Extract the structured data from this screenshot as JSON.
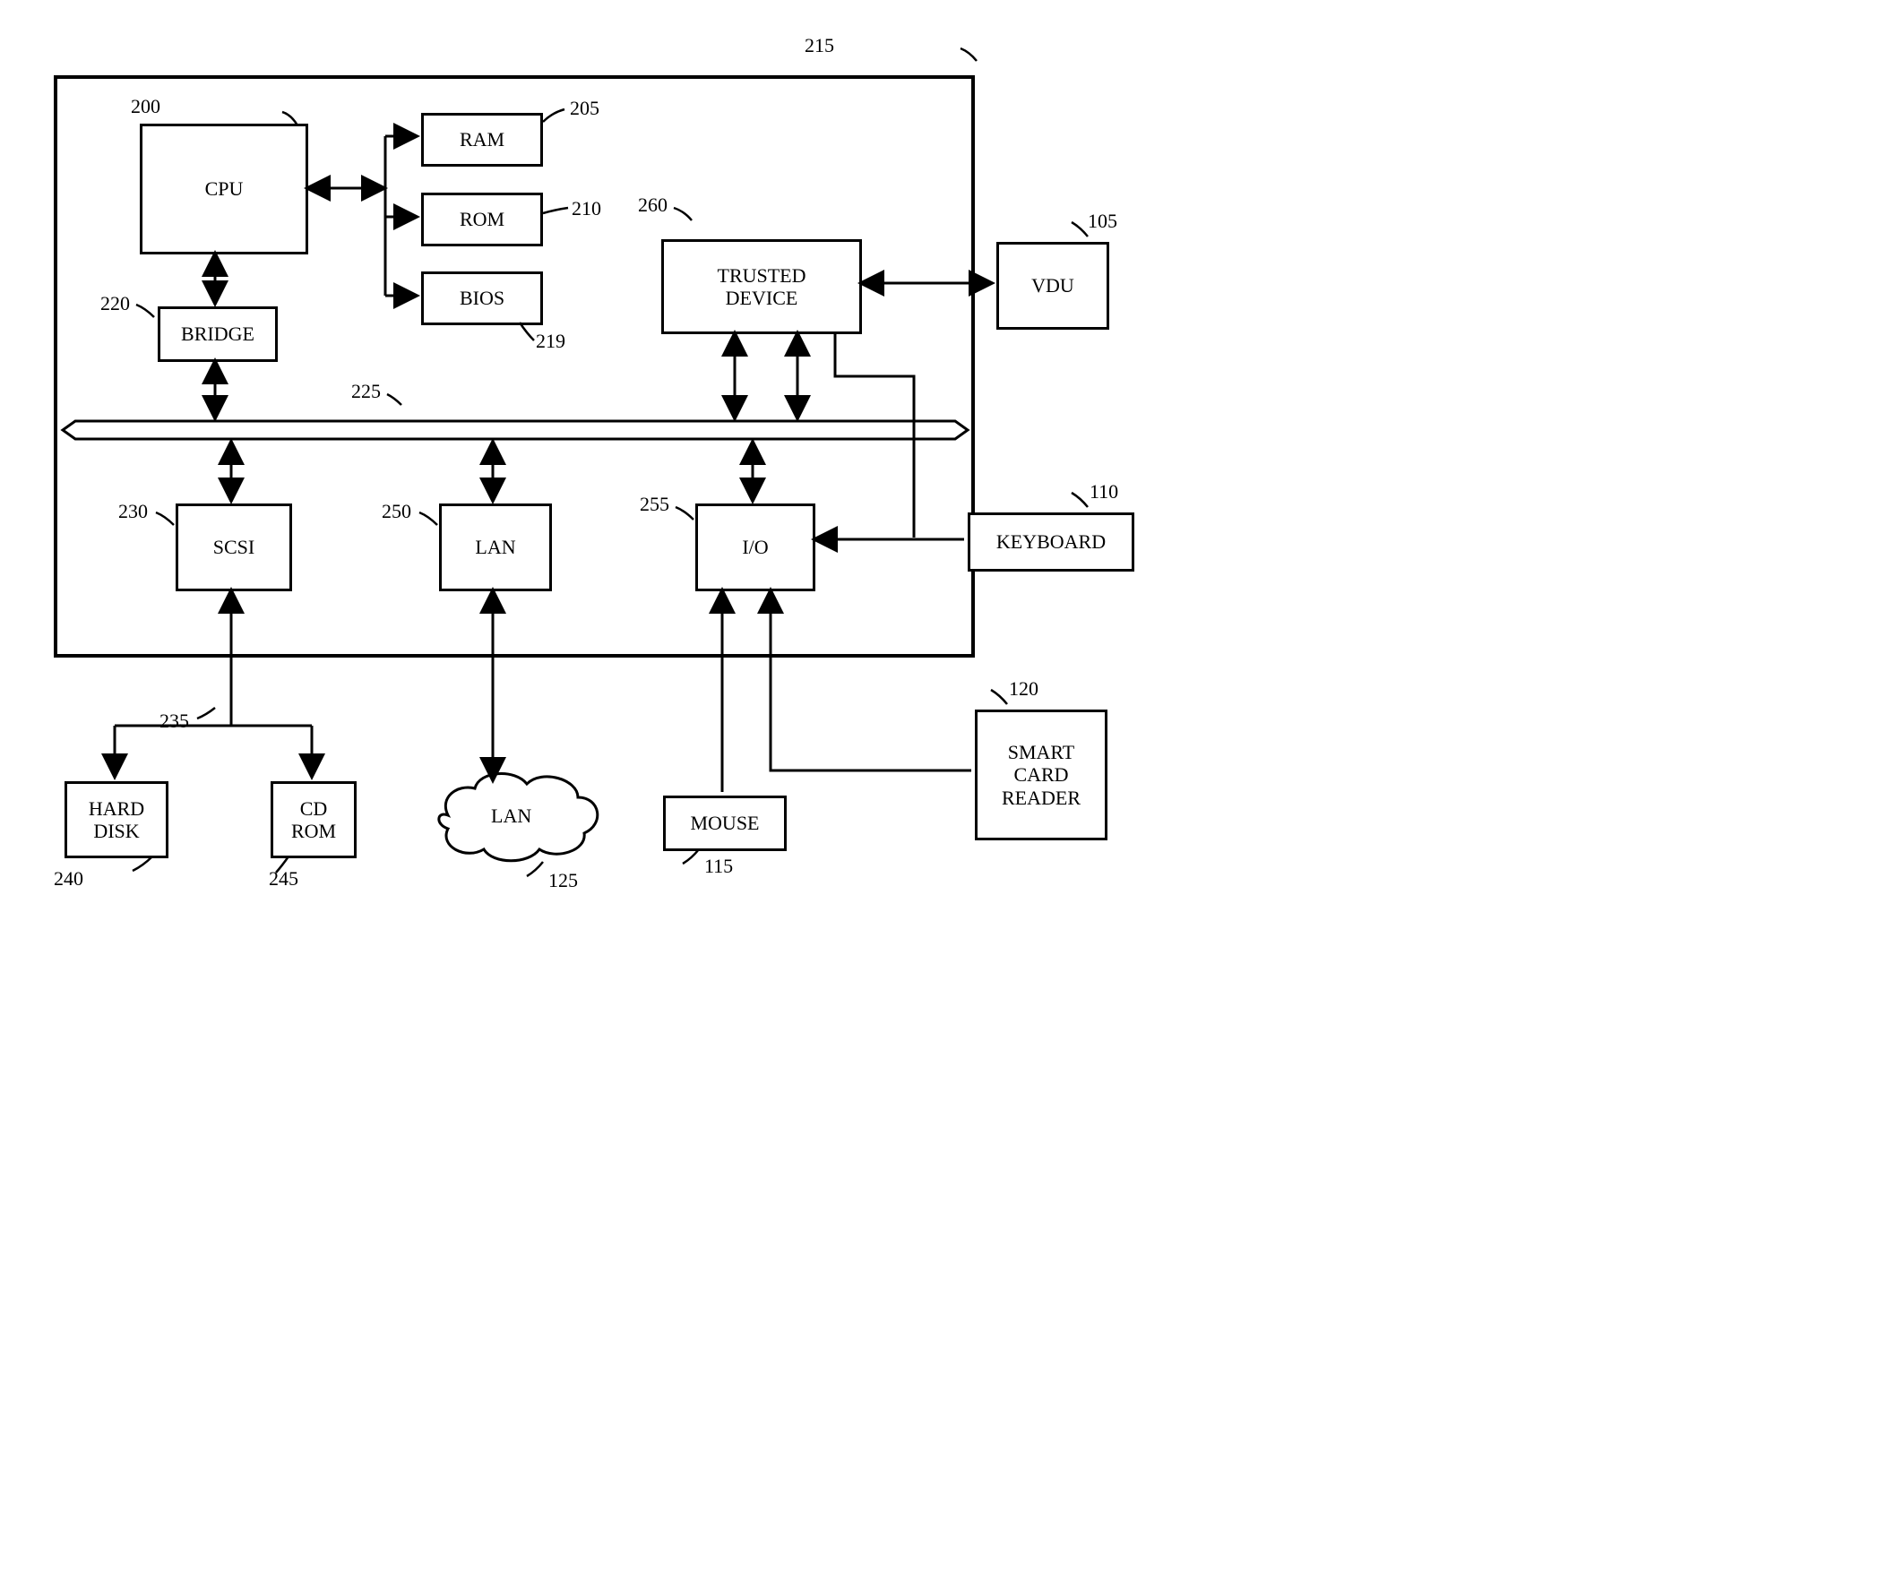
{
  "boxes": {
    "cpu": "CPU",
    "ram": "RAM",
    "rom": "ROM",
    "bios": "BIOS",
    "trusted": "TRUSTED\nDEVICE",
    "vdu": "VDU",
    "bridge": "BRIDGE",
    "scsi": "SCSI",
    "lan": "LAN",
    "io": "I/O",
    "keyboard": "KEYBOARD",
    "harddisk": "HARD\nDISK",
    "cdrom": "CD\nROM",
    "lan_cloud": "LAN",
    "mouse": "MOUSE",
    "smartcard": "SMART\nCARD\nREADER"
  },
  "labels": {
    "l200": "200",
    "l205": "205",
    "l210": "210",
    "l215": "215",
    "l219": "219",
    "l220": "220",
    "l225": "225",
    "l230": "230",
    "l235": "235",
    "l240": "240",
    "l245": "245",
    "l250": "250",
    "l255": "255",
    "l260": "260",
    "l105": "105",
    "l110": "110",
    "l115": "115",
    "l120": "120",
    "l125": "125"
  }
}
